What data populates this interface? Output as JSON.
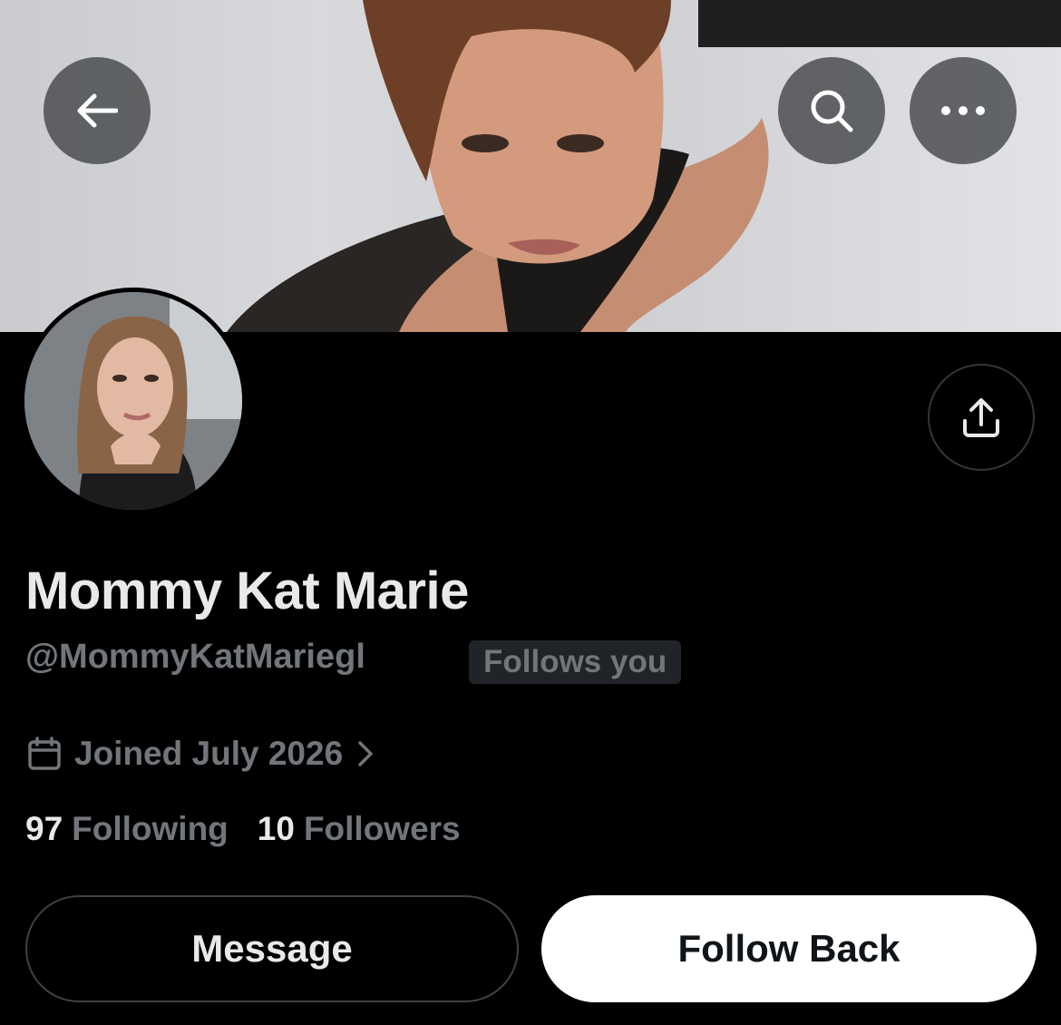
{
  "header": {
    "back_icon": "arrow-left-icon",
    "search_icon": "search-icon",
    "more_icon": "more-horizontal-icon"
  },
  "profile": {
    "display_name": "Mommy Kat Marie",
    "handle": "@MommyKatMariegl",
    "follows_you_badge": "Follows you",
    "joined": "Joined July 2026",
    "following_count": "97",
    "following_label": "Following",
    "followers_count": "10",
    "followers_label": "Followers"
  },
  "actions": {
    "share_icon": "share-icon",
    "message_label": "Message",
    "follow_back_label": "Follow Back"
  },
  "colors": {
    "background": "#000000",
    "primary_text": "#e7e9ea",
    "secondary_text": "#71767b",
    "badge_bg": "#202327",
    "follow_button_bg": "#ffffff"
  }
}
